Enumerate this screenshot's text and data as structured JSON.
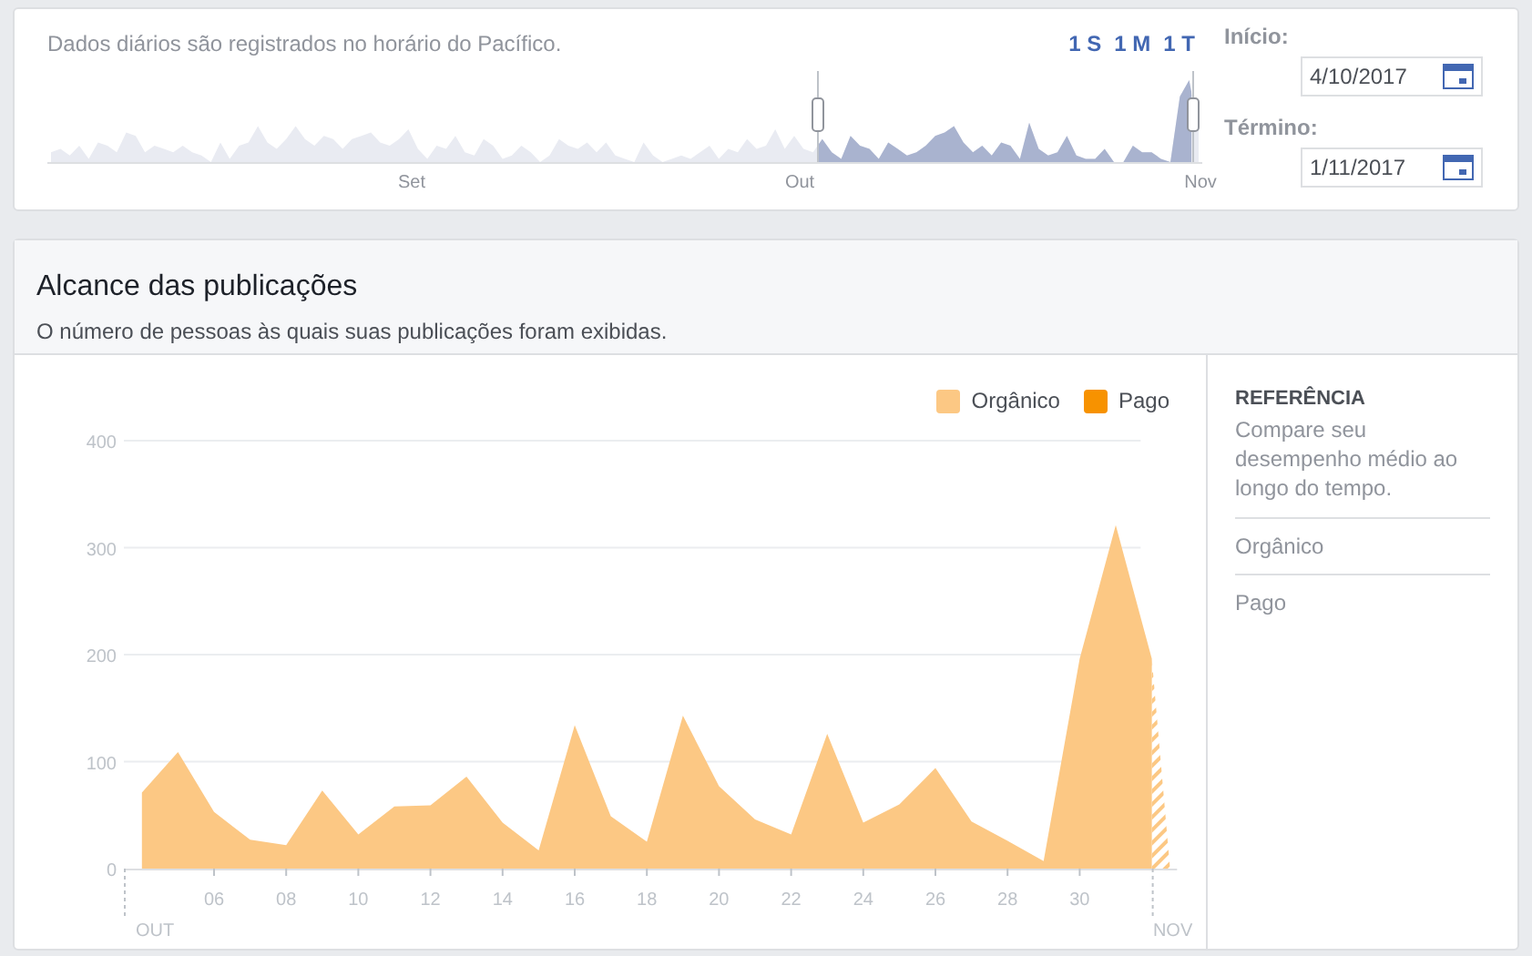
{
  "range_panel": {
    "note": "Dados diários são registrados no horário do Pacífico.",
    "range_buttons": [
      {
        "label": "1 S",
        "selected": false
      },
      {
        "label": "1 M",
        "selected": false
      },
      {
        "label": "1 T",
        "selected": false
      }
    ],
    "month_labels": [
      "Set",
      "Out",
      "Nov"
    ],
    "start": {
      "label": "Início:",
      "value": "4/10/2017"
    },
    "end": {
      "label": "Término:",
      "value": "1/11/2017"
    }
  },
  "reach_card": {
    "title": "Alcance das publicações",
    "subtitle": "O número de pessoas às quais suas publicações foram exibidas.",
    "month_labels": [
      "OUT",
      "NOV"
    ],
    "chart_data": {
      "type": "area",
      "x": [
        4,
        5,
        6,
        7,
        8,
        9,
        10,
        11,
        12,
        13,
        14,
        15,
        16,
        17,
        18,
        19,
        20,
        21,
        22,
        23,
        24,
        25,
        26,
        27,
        28,
        29,
        30,
        31,
        32
      ],
      "series": [
        {
          "name": "Orgânico",
          "color": "#fcc884",
          "values": [
            71,
            109,
            53,
            27,
            22,
            73,
            32,
            58,
            59,
            86,
            43,
            17,
            134,
            49,
            25,
            143,
            77,
            46,
            32,
            126,
            43,
            60,
            94,
            44,
            26,
            7,
            196,
            321,
            196
          ]
        },
        {
          "name": "Pago",
          "color": "#f79200",
          "values": [
            null,
            null,
            null,
            null,
            null,
            null,
            null,
            null,
            null,
            null,
            null,
            null,
            null,
            null,
            null,
            null,
            null,
            null,
            null,
            null,
            null,
            null,
            null,
            null,
            null,
            null,
            null,
            null,
            null
          ]
        }
      ],
      "xlim": [
        3.5,
        32.7
      ],
      "ylim": [
        0,
        400
      ],
      "yticks": [
        0,
        100,
        200,
        300,
        400
      ],
      "grid": true,
      "xticks": [
        {
          "value": 6,
          "label": "06"
        },
        {
          "value": 8,
          "label": "08"
        },
        {
          "value": 10,
          "label": "10"
        },
        {
          "value": 12,
          "label": "12"
        },
        {
          "value": 14,
          "label": "14"
        },
        {
          "value": 16,
          "label": "16"
        },
        {
          "value": 18,
          "label": "18"
        },
        {
          "value": 20,
          "label": "20"
        },
        {
          "value": 22,
          "label": "22"
        },
        {
          "value": 24,
          "label": "24"
        },
        {
          "value": 26,
          "label": "26"
        },
        {
          "value": 28,
          "label": "28"
        },
        {
          "value": 30,
          "label": "30"
        }
      ]
    },
    "reference": {
      "heading": "REFERÊNCIA",
      "text": "Compare seu desempenho médio ao longo do tempo.",
      "items": [
        "Orgânico",
        "Pago"
      ]
    }
  }
}
